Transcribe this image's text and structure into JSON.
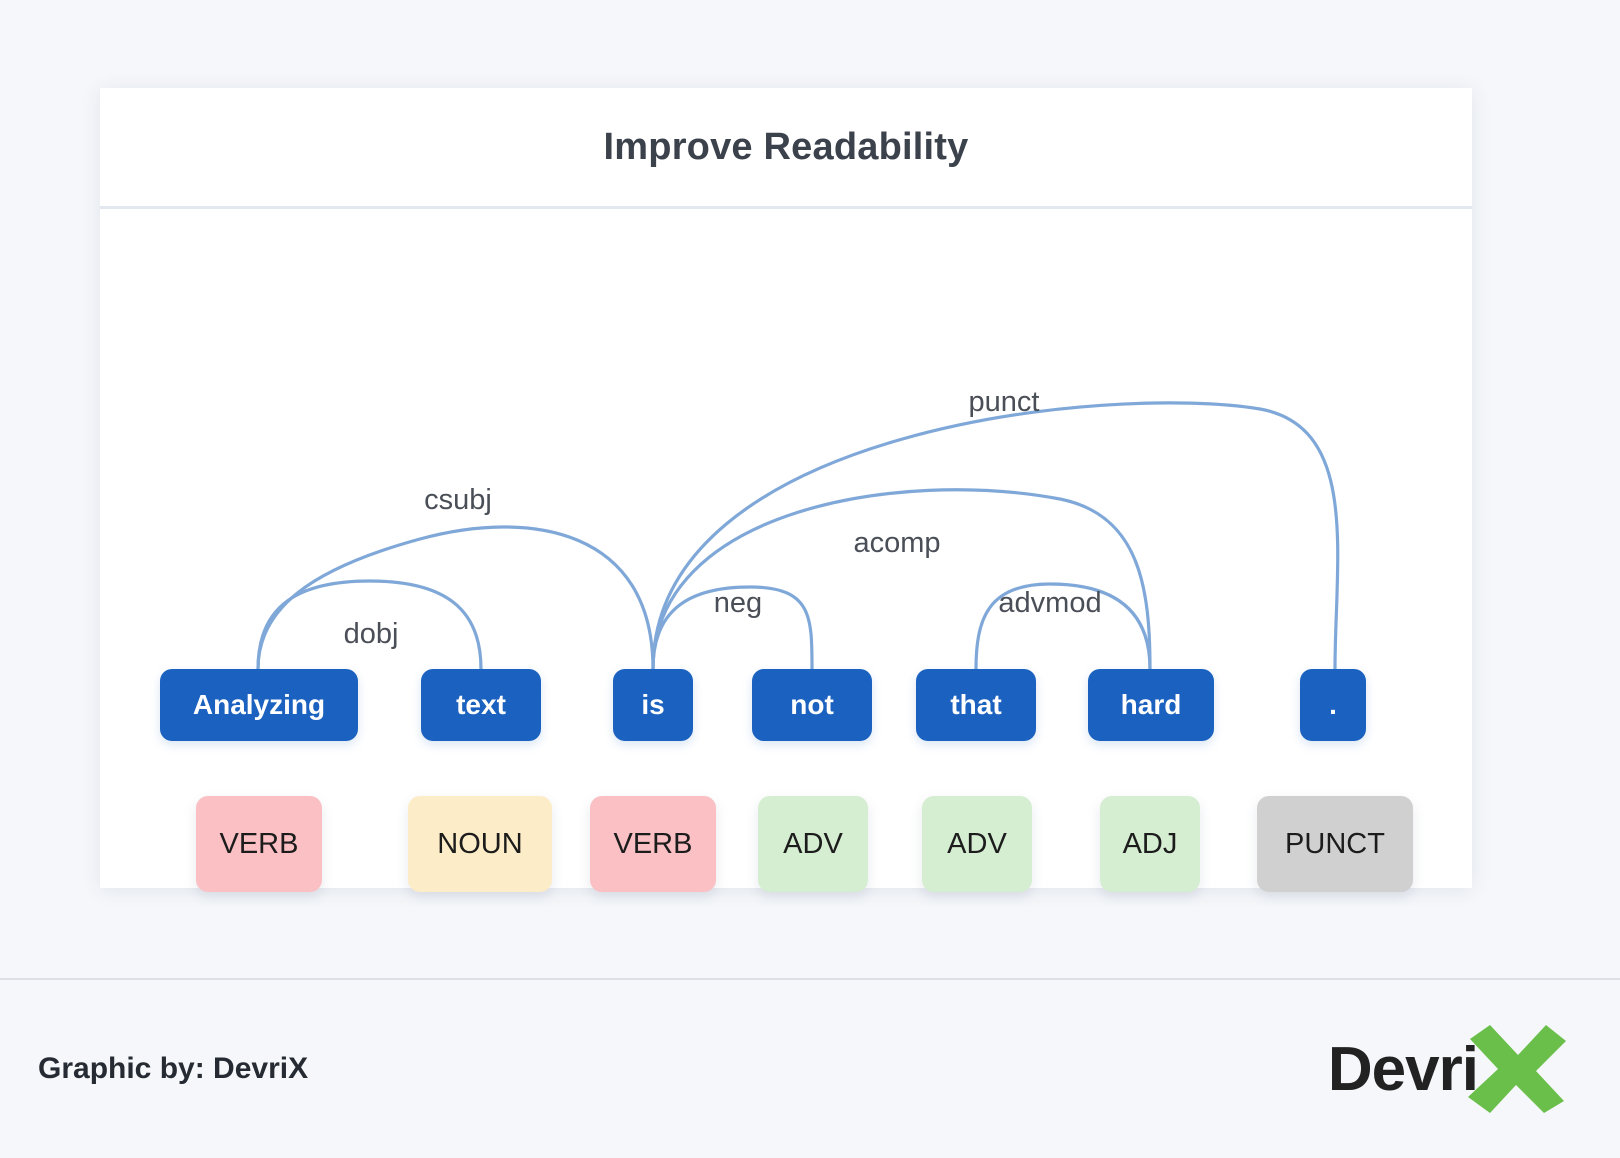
{
  "card": {
    "title": "Improve Readability"
  },
  "parse": {
    "tokens": [
      {
        "text": "Analyzing",
        "pos": "VERB",
        "pos_color": "#fac0c4"
      },
      {
        "text": "text",
        "pos": "NOUN",
        "pos_color": "#fdecc8"
      },
      {
        "text": "is",
        "pos": "VERB",
        "pos_color": "#fac0c4"
      },
      {
        "text": "not",
        "pos": "ADV",
        "pos_color": "#d5eed1"
      },
      {
        "text": "that",
        "pos": "ADV",
        "pos_color": "#d5eed1"
      },
      {
        "text": "hard",
        "pos": "ADJ",
        "pos_color": "#d5eed1"
      },
      {
        "text": ".",
        "pos": "PUNCT",
        "pos_color": "#d0d0d0"
      }
    ],
    "arcs": [
      {
        "label": "csubj",
        "from": "is",
        "to": "Analyzing"
      },
      {
        "label": "dobj",
        "from": "Analyzing",
        "to": "text"
      },
      {
        "label": "neg",
        "from": "is",
        "to": "not"
      },
      {
        "label": "acomp",
        "from": "is",
        "to": "hard"
      },
      {
        "label": "advmod",
        "from": "hard",
        "to": "that"
      },
      {
        "label": "punct",
        "from": "is",
        "to": "."
      }
    ],
    "token_color": "#1b62c0",
    "arc_color": "#7fa8d9"
  },
  "footer": {
    "credit": "Graphic by: DevriX",
    "logo_text": "Devri",
    "logo_mark": "X",
    "logo_mark_color": "#6abf4b"
  }
}
